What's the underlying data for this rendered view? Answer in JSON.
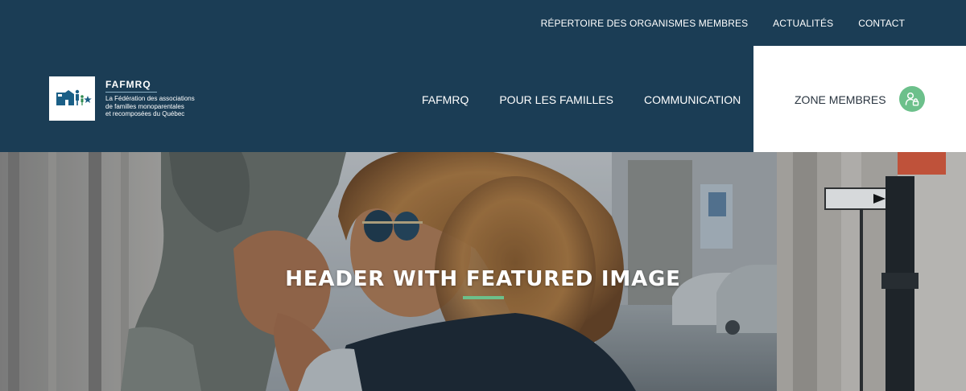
{
  "top_nav": {
    "items": [
      "RÉPERTOIRE DES ORGANISMES MEMBRES",
      "ACTUALITÉS",
      "CONTACT"
    ]
  },
  "logo": {
    "name": "FAFMRQ",
    "description_lines": [
      "La Fédération des associations",
      "de familles monoparentales",
      "et recomposées du Québec"
    ]
  },
  "main_nav": {
    "items": [
      "FAFMRQ",
      "POUR LES FAMILLES",
      "COMMUNICATION"
    ]
  },
  "member_zone": {
    "label": "ZONE MEMBRES",
    "icon": "user-lock-icon"
  },
  "hero": {
    "title": "HEADER WITH FEATURED IMAGE"
  },
  "colors": {
    "header_bg": "#1b3d55",
    "accent_green": "#6cc08b",
    "white": "#ffffff"
  }
}
